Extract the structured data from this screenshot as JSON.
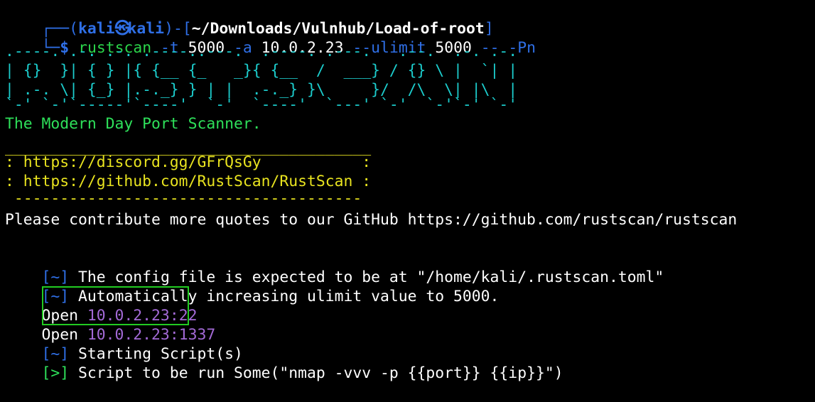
{
  "prompt": {
    "frame_top_left": "┌──(",
    "user": "kali",
    "icon": "kali-dragon-icon",
    "icon_glyph": "㉿",
    "host": "kali",
    "frame_mid": ")-[",
    "path": "~/Downloads/Vulnhub/Load-of-root",
    "frame_end": "]",
    "frame_bottom_left": "└─",
    "symbol": "$"
  },
  "command": {
    "program": "rustscan",
    "args": [
      {
        "text": " -t ",
        "type": "flag"
      },
      {
        "text": "5000",
        "type": "arg"
      },
      {
        "text": " -a ",
        "type": "flag"
      },
      {
        "text": "10.0.2.23",
        "type": "arg"
      },
      {
        "text": " --ulimit ",
        "type": "flag"
      },
      {
        "text": "5000",
        "type": "arg"
      },
      {
        "text": " -- -Pn",
        "type": "flag"
      }
    ]
  },
  "banner": [
    ".----. .-. .-. .----..---.  .----. .---.   .--.  .-. .-.",
    "| {}  }| { } |{ {__ {_   _}{ {__  /  ___} / {} \\ |  `| |",
    "| .-. \\| {_} |.-._} } | |  .-._} }\\     }/  /\\  \\| |\\  |",
    "`-' `-'`-----'`----'  `-'  `----'  `---' `-'  `-'`-' `-'"
  ],
  "tagline": "The Modern Day Port Scanner.",
  "links_box": {
    "top_rule": "________________________________________",
    "line1": ": https://discord.gg/GFrQsGy           :",
    "line2": ": https://github.com/RustScan/RustScan :",
    "bottom_rule": " --------------------------------------"
  },
  "contribute": "Please contribute more quotes to our GitHub https://github.com/rustscan/rustscan",
  "info_lines": [
    {
      "bracket": "[~]",
      "text": " The config file is expected to be at \"/home/kali/.rustscan.toml\""
    },
    {
      "bracket": "[~]",
      "text": " Automatically increasing ulimit value to 5000."
    }
  ],
  "open_ports": [
    {
      "label": "Open",
      "address": " 10.0.2.23:22"
    },
    {
      "label": "Open",
      "address": " 10.0.2.23:1337"
    }
  ],
  "script_lines": [
    {
      "bracket": "[~]",
      "text": " Starting Script(s)",
      "bracket_color": "blue"
    },
    {
      "bracket": "[>]",
      "text": " Script to be run Some(\"nmap -vvv -p {{port}} {{ip}}\")",
      "bracket_color": "green"
    }
  ],
  "colors": {
    "background": "#000000",
    "prompt_blue": "#2f6fe6",
    "command_green": "#2bd44a",
    "banner_cyan": "#1ccccc",
    "tagline_green": "#2ee05a",
    "links_yellow": "#e8e31f",
    "address_purple": "#a36ad6",
    "highlight_box": "#22cc22"
  }
}
